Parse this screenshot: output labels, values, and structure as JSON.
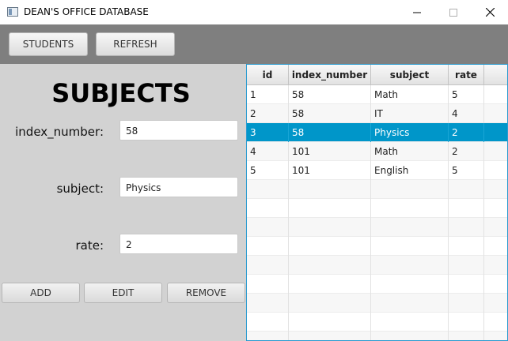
{
  "window": {
    "title": "DEAN'S OFFICE DATABASE"
  },
  "toolbar": {
    "students_label": "STUDENTS",
    "refresh_label": "REFRESH"
  },
  "form": {
    "heading": "SUBJECTS",
    "index_number": {
      "label": "index_number:",
      "value": "58"
    },
    "subject": {
      "label": "subject:",
      "value": "Physics"
    },
    "rate": {
      "label": "rate:",
      "value": "2"
    },
    "add_label": "ADD",
    "edit_label": "EDIT",
    "remove_label": "REMOVE"
  },
  "table": {
    "columns": [
      "id",
      "index_number",
      "subject",
      "rate"
    ],
    "rows": [
      [
        "1",
        "58",
        "Math",
        "5"
      ],
      [
        "2",
        "58",
        "IT",
        "4"
      ],
      [
        "3",
        "58",
        "Physics",
        "2"
      ],
      [
        "4",
        "101",
        "Math",
        "2"
      ],
      [
        "5",
        "101",
        "English",
        "5"
      ]
    ],
    "selected_row": 3
  },
  "colors": {
    "selection": "#0096c9",
    "toolbar": "#7f7f7f",
    "panel": "#d2d2d2"
  }
}
